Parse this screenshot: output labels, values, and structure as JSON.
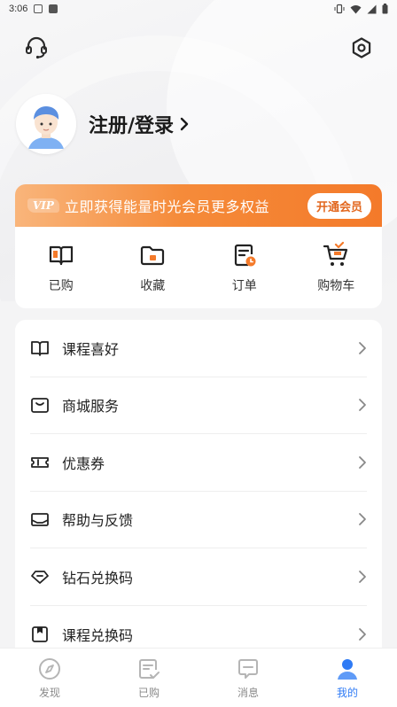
{
  "status_bar": {
    "time": "3:06",
    "icons": [
      "notification-a-icon",
      "notification-square-icon",
      "vibrate-icon",
      "wifi-icon",
      "signal-icon",
      "battery-icon"
    ]
  },
  "header": {
    "support_icon": "headset-icon",
    "settings_icon": "hexagon-gear-icon"
  },
  "profile": {
    "login_label": "注册/登录"
  },
  "vip": {
    "badge": "VIP",
    "text": "立即获得能量时光会员更多权益",
    "button": "开通会员",
    "colors": {
      "start": "#f9b57b",
      "end": "#f47a2a",
      "button_text": "#e2671e"
    }
  },
  "quick_actions": [
    {
      "label": "已购",
      "icon": "book-icon"
    },
    {
      "label": "收藏",
      "icon": "folder-icon"
    },
    {
      "label": "订单",
      "icon": "order-clock-icon"
    },
    {
      "label": "购物车",
      "icon": "cart-icon"
    }
  ],
  "menu": [
    {
      "label": "课程喜好",
      "icon": "open-book-icon"
    },
    {
      "label": "商城服务",
      "icon": "shopping-bag-icon"
    },
    {
      "label": "优惠券",
      "icon": "ticket-icon"
    },
    {
      "label": "帮助与反馈",
      "icon": "mail-icon"
    },
    {
      "label": "钻石兑换码",
      "icon": "diamond-icon"
    },
    {
      "label": "课程兑换码",
      "icon": "bookmark-icon"
    }
  ],
  "bottom_nav": [
    {
      "label": "发现",
      "icon": "compass-icon",
      "active": false
    },
    {
      "label": "已购",
      "icon": "purchased-icon",
      "active": false
    },
    {
      "label": "消息",
      "icon": "message-icon",
      "active": false
    },
    {
      "label": "我的",
      "icon": "user-icon",
      "active": true
    }
  ],
  "accent_color": "#2f7bf5",
  "orange_accent": "#f47a2a"
}
